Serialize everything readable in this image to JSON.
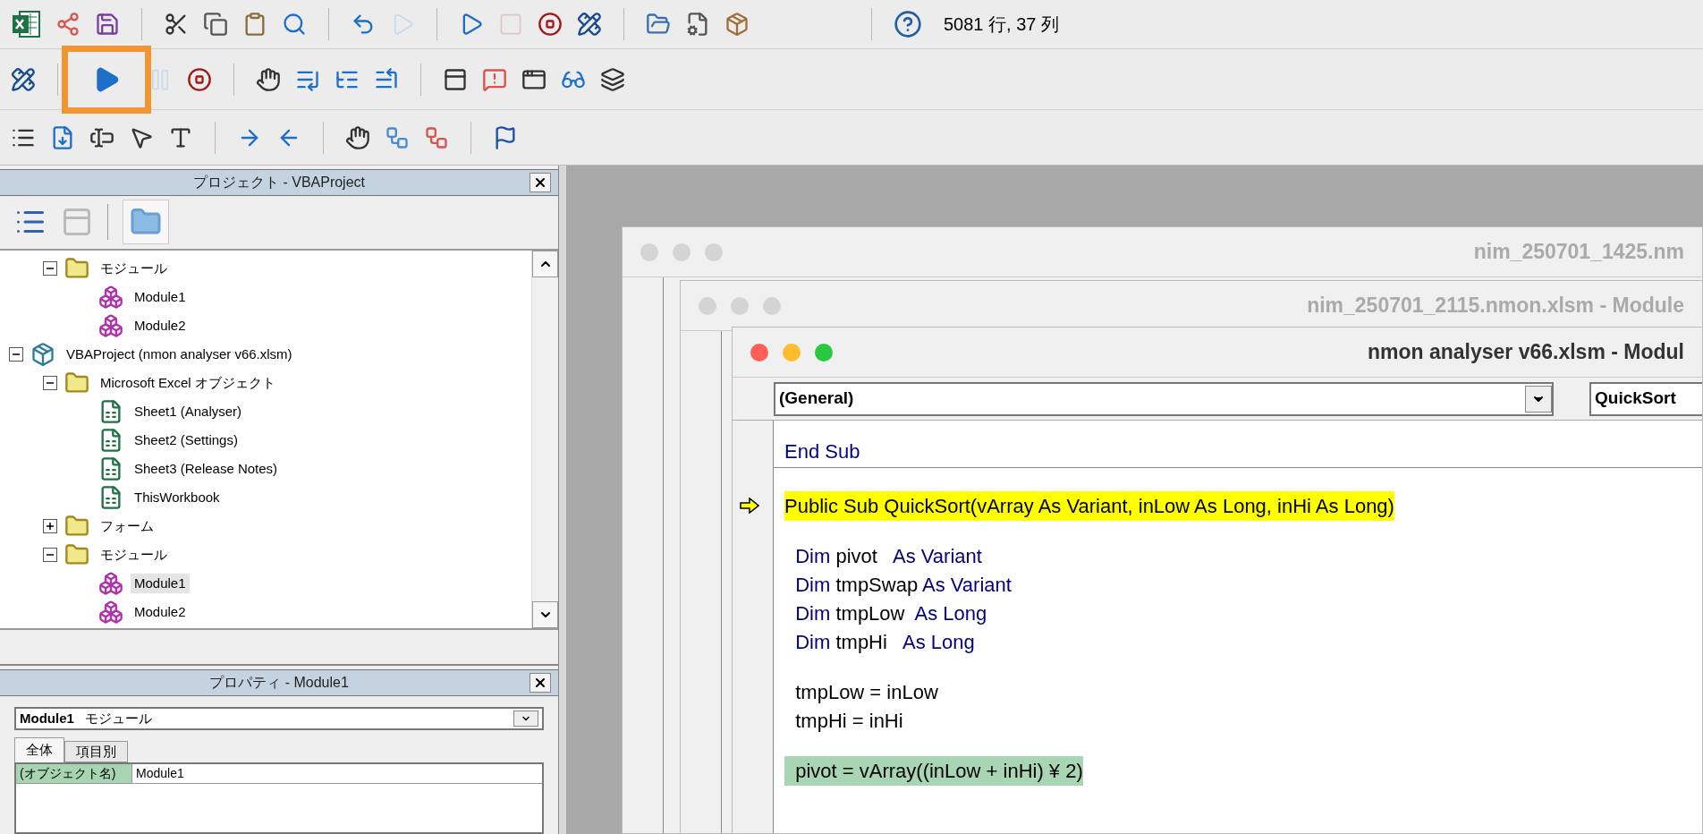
{
  "toolbar": {
    "status": "5081 行, 37 列",
    "run_button_outlined": true
  },
  "project_panel": {
    "title": "プロジェクト - VBAProject",
    "tree": [
      {
        "kind": "hidden",
        "children": [
          {
            "kind": "folder",
            "label": "モジュール",
            "expanded": true,
            "selected": false,
            "children": [
              {
                "kind": "module",
                "label": "Module1",
                "selected": false
              },
              {
                "kind": "module",
                "label": "Module2",
                "selected": false
              }
            ]
          }
        ]
      },
      {
        "kind": "project",
        "label": "VBAProject (nmon analyser v66.xlsm)",
        "expanded": true,
        "selected": false,
        "children": [
          {
            "kind": "folder",
            "label": "Microsoft Excel オブジェクト",
            "expanded": true,
            "selected": false,
            "children": [
              {
                "kind": "sheet",
                "label": "Sheet1 (Analyser)",
                "selected": false
              },
              {
                "kind": "sheet",
                "label": "Sheet2 (Settings)",
                "selected": false
              },
              {
                "kind": "sheet",
                "label": "Sheet3 (Release Notes)",
                "selected": false
              },
              {
                "kind": "sheet",
                "label": "ThisWorkbook",
                "selected": false
              }
            ]
          },
          {
            "kind": "folder",
            "label": "フォーム",
            "expanded": false,
            "selected": false
          },
          {
            "kind": "folder",
            "label": "モジュール",
            "expanded": true,
            "selected": false,
            "children": [
              {
                "kind": "module",
                "label": "Module1",
                "selected": true
              },
              {
                "kind": "module",
                "label": "Module2",
                "selected": false
              }
            ]
          }
        ]
      }
    ]
  },
  "properties_panel": {
    "title": "プロパティ - Module1",
    "object_name": "Module1",
    "object_type": "モジュール",
    "tabs": [
      {
        "label": "全体",
        "selected": true
      },
      {
        "label": "項目別",
        "selected": false
      }
    ],
    "rows": [
      {
        "name": "(オブジェクト名)",
        "value": "Module1"
      }
    ]
  },
  "windows": [
    {
      "title": "nim_250701_1425.nm",
      "active": false
    },
    {
      "title": "nim_250701_2115.nmon.xlsm - Module",
      "active": false
    },
    {
      "title": "nmon analyser v66.xlsm - Modul",
      "active": true,
      "object_dropdown": "(General)",
      "procedure_dropdown": "QuickSort",
      "lines": [
        {
          "kind": "code",
          "execution_point": false,
          "selected": false,
          "segments": [
            {
              "text": "End Sub",
              "kind": "keyword"
            }
          ]
        },
        {
          "kind": "separator"
        },
        {
          "kind": "blank"
        },
        {
          "kind": "code",
          "execution_point": true,
          "selected": false,
          "segments": [
            {
              "text": "Public Sub QuickSort(vArray As Variant, inLow As Long, inHi As Long)",
              "kind": "plain"
            }
          ]
        },
        {
          "kind": "blank"
        },
        {
          "kind": "code",
          "execution_point": false,
          "selected": false,
          "segments": [
            {
              "text": "  Dim",
              "kind": "keyword"
            },
            {
              "text": " pivot   ",
              "kind": "plain"
            },
            {
              "text": "As Variant",
              "kind": "keyword"
            }
          ]
        },
        {
          "kind": "code",
          "execution_point": false,
          "selected": false,
          "segments": [
            {
              "text": "  Dim",
              "kind": "keyword"
            },
            {
              "text": " tmpSwap ",
              "kind": "plain"
            },
            {
              "text": "As Variant",
              "kind": "keyword"
            }
          ]
        },
        {
          "kind": "code",
          "execution_point": false,
          "selected": false,
          "segments": [
            {
              "text": "  Dim",
              "kind": "keyword"
            },
            {
              "text": " tmpLow  ",
              "kind": "plain"
            },
            {
              "text": "As Long",
              "kind": "keyword"
            }
          ]
        },
        {
          "kind": "code",
          "execution_point": false,
          "selected": false,
          "segments": [
            {
              "text": "  Dim",
              "kind": "keyword"
            },
            {
              "text": " tmpHi   ",
              "kind": "plain"
            },
            {
              "text": "As Long",
              "kind": "keyword"
            }
          ]
        },
        {
          "kind": "blank"
        },
        {
          "kind": "code",
          "execution_point": false,
          "selected": false,
          "segments": [
            {
              "text": "  tmpLow = inLow",
              "kind": "plain"
            }
          ]
        },
        {
          "kind": "code",
          "execution_point": false,
          "selected": false,
          "segments": [
            {
              "text": "  tmpHi = inHi",
              "kind": "plain"
            }
          ]
        },
        {
          "kind": "blank"
        },
        {
          "kind": "code",
          "execution_point": false,
          "selected": true,
          "segments": [
            {
              "text": "  pivot = vArray((inLow + inHi) ¥ 2)",
              "kind": "plain"
            }
          ]
        }
      ]
    }
  ]
}
